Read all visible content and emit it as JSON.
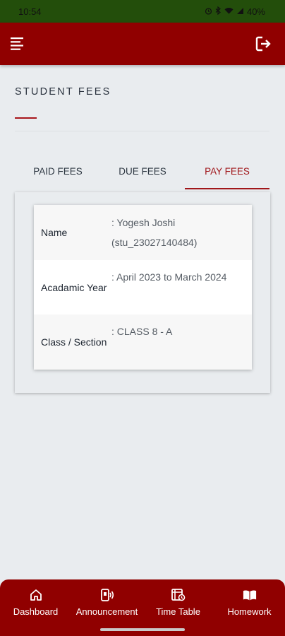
{
  "status_bar": {
    "time": "10:54",
    "battery": "40%"
  },
  "app_bar": {
    "menu_icon": "menu-icon",
    "logout_icon": "logout-icon"
  },
  "page": {
    "title": "STUDENT FEES"
  },
  "tabs": [
    {
      "label": "PAID FEES",
      "active": false
    },
    {
      "label": "DUE FEES",
      "active": false
    },
    {
      "label": "PAY FEES",
      "active": true
    }
  ],
  "student_info": [
    {
      "label": "Name",
      "value": ": Yogesh Joshi (stu_23027140484)"
    },
    {
      "label": "Acadamic Year",
      "value": ": April 2023 to March 2024"
    },
    {
      "label": "Class / Section",
      "value": ": CLASS 8 - A"
    }
  ],
  "bottom_nav": [
    {
      "label": "Dashboard",
      "icon": "home-icon"
    },
    {
      "label": "Announcement",
      "icon": "announcement-icon"
    },
    {
      "label": "Time Table",
      "icon": "timetable-icon"
    },
    {
      "label": "Homework",
      "icon": "book-icon"
    }
  ],
  "colors": {
    "primary": "#900000",
    "status_bar": "#234e0b",
    "accent": "#a0161a",
    "background": "#e9ecef"
  }
}
